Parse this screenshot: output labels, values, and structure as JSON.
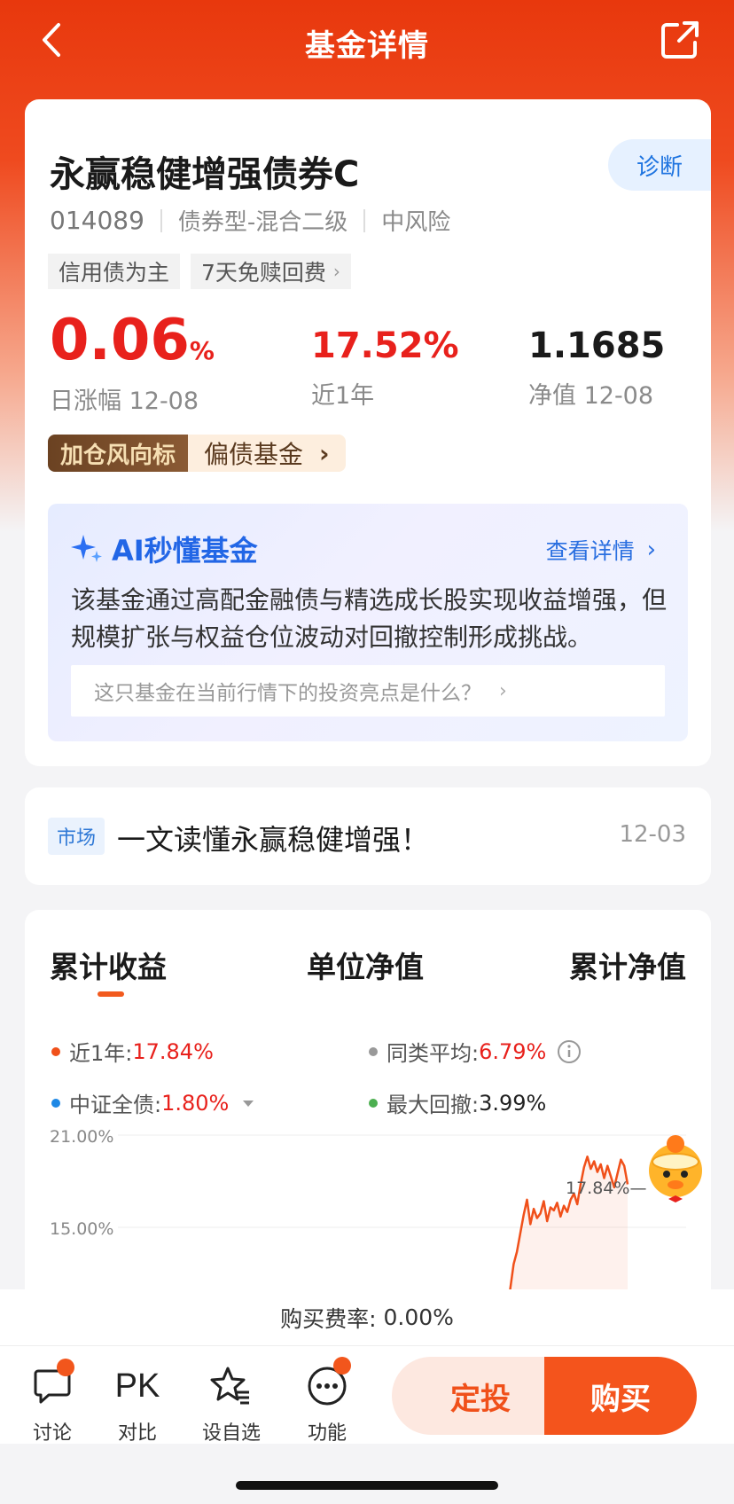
{
  "header": {
    "title": "基金详情",
    "back_icon": "chevron-left-icon",
    "share_icon": "share-icon"
  },
  "fund": {
    "name": "永赢稳健增强债券C",
    "diagnose_label": "诊断",
    "code": "014089",
    "type": "债券型-混合二级",
    "risk": "中风险",
    "tags": [
      "信用债为主",
      "7天免赎回费"
    ]
  },
  "metrics": {
    "daily_change": "0.06",
    "daily_change_unit": "%",
    "daily_change_label": "日涨幅 12-08",
    "year_return": "17.52%",
    "year_return_label": "近1年",
    "nav": "1.1685",
    "nav_label": "净值 12-08"
  },
  "wind": {
    "badge": "加仓风向标",
    "text": "偏债基金"
  },
  "ai": {
    "title": "AI秒懂基金",
    "more": "查看详情",
    "desc": "该基金通过高配金融债与精选成长股实现收益增强，但规模扩张与权益仓位波动对回撤控制形成挑战。",
    "question": "这只基金在当前行情下的投资亮点是什么？"
  },
  "news": {
    "tag": "市场",
    "title": "一文读懂永赢稳健增强！",
    "date": "12-03"
  },
  "chart_tabs": [
    "累计收益",
    "单位净值",
    "累计净值"
  ],
  "legend": {
    "fund_label": "近1年:",
    "fund_value": "17.84%",
    "peer_label": "同类平均:",
    "peer_value": "6.79%",
    "index_label": "中证全债:",
    "index_value": "1.80%",
    "drawdown_label": "最大回撤:",
    "drawdown_value": "3.99%",
    "colors": {
      "fund": "#f0501a",
      "peer": "#999999",
      "index": "#1e88e5",
      "drawdown": "#4caf50"
    }
  },
  "chart_data": {
    "type": "line",
    "y_ticks": [
      "21.00%",
      "15.00%"
    ],
    "end_label": "17.84%",
    "series": [
      {
        "name": "近1年",
        "color": "#f0501a",
        "values": [
          8.2,
          9.5,
          11.0,
          12.6,
          13.4,
          14.6,
          15.8,
          16.8,
          15.2,
          16.2,
          15.6,
          15.9,
          16.7,
          15.4,
          16.3,
          16.1,
          16.6,
          15.7,
          16.4,
          16.0,
          16.8,
          17.2,
          16.5,
          17.8,
          18.9,
          19.6,
          18.8,
          19.3,
          18.6,
          19.1,
          18.2,
          19.0,
          18.3,
          17.6,
          18.5,
          19.4,
          19.0,
          17.8
        ]
      }
    ],
    "ylim": [
      10,
      21
    ]
  },
  "fee": {
    "label": "购买费率:",
    "value": "0.00%"
  },
  "bottom_nav": [
    {
      "label": "讨论",
      "icon": "chat-bubble-icon"
    },
    {
      "label": "对比",
      "icon": "PK"
    },
    {
      "label": "设自选",
      "icon": "star-list-icon"
    },
    {
      "label": "功能",
      "icon": "more-dots-icon"
    }
  ],
  "actions": {
    "sip": "定投",
    "buy": "购买"
  }
}
